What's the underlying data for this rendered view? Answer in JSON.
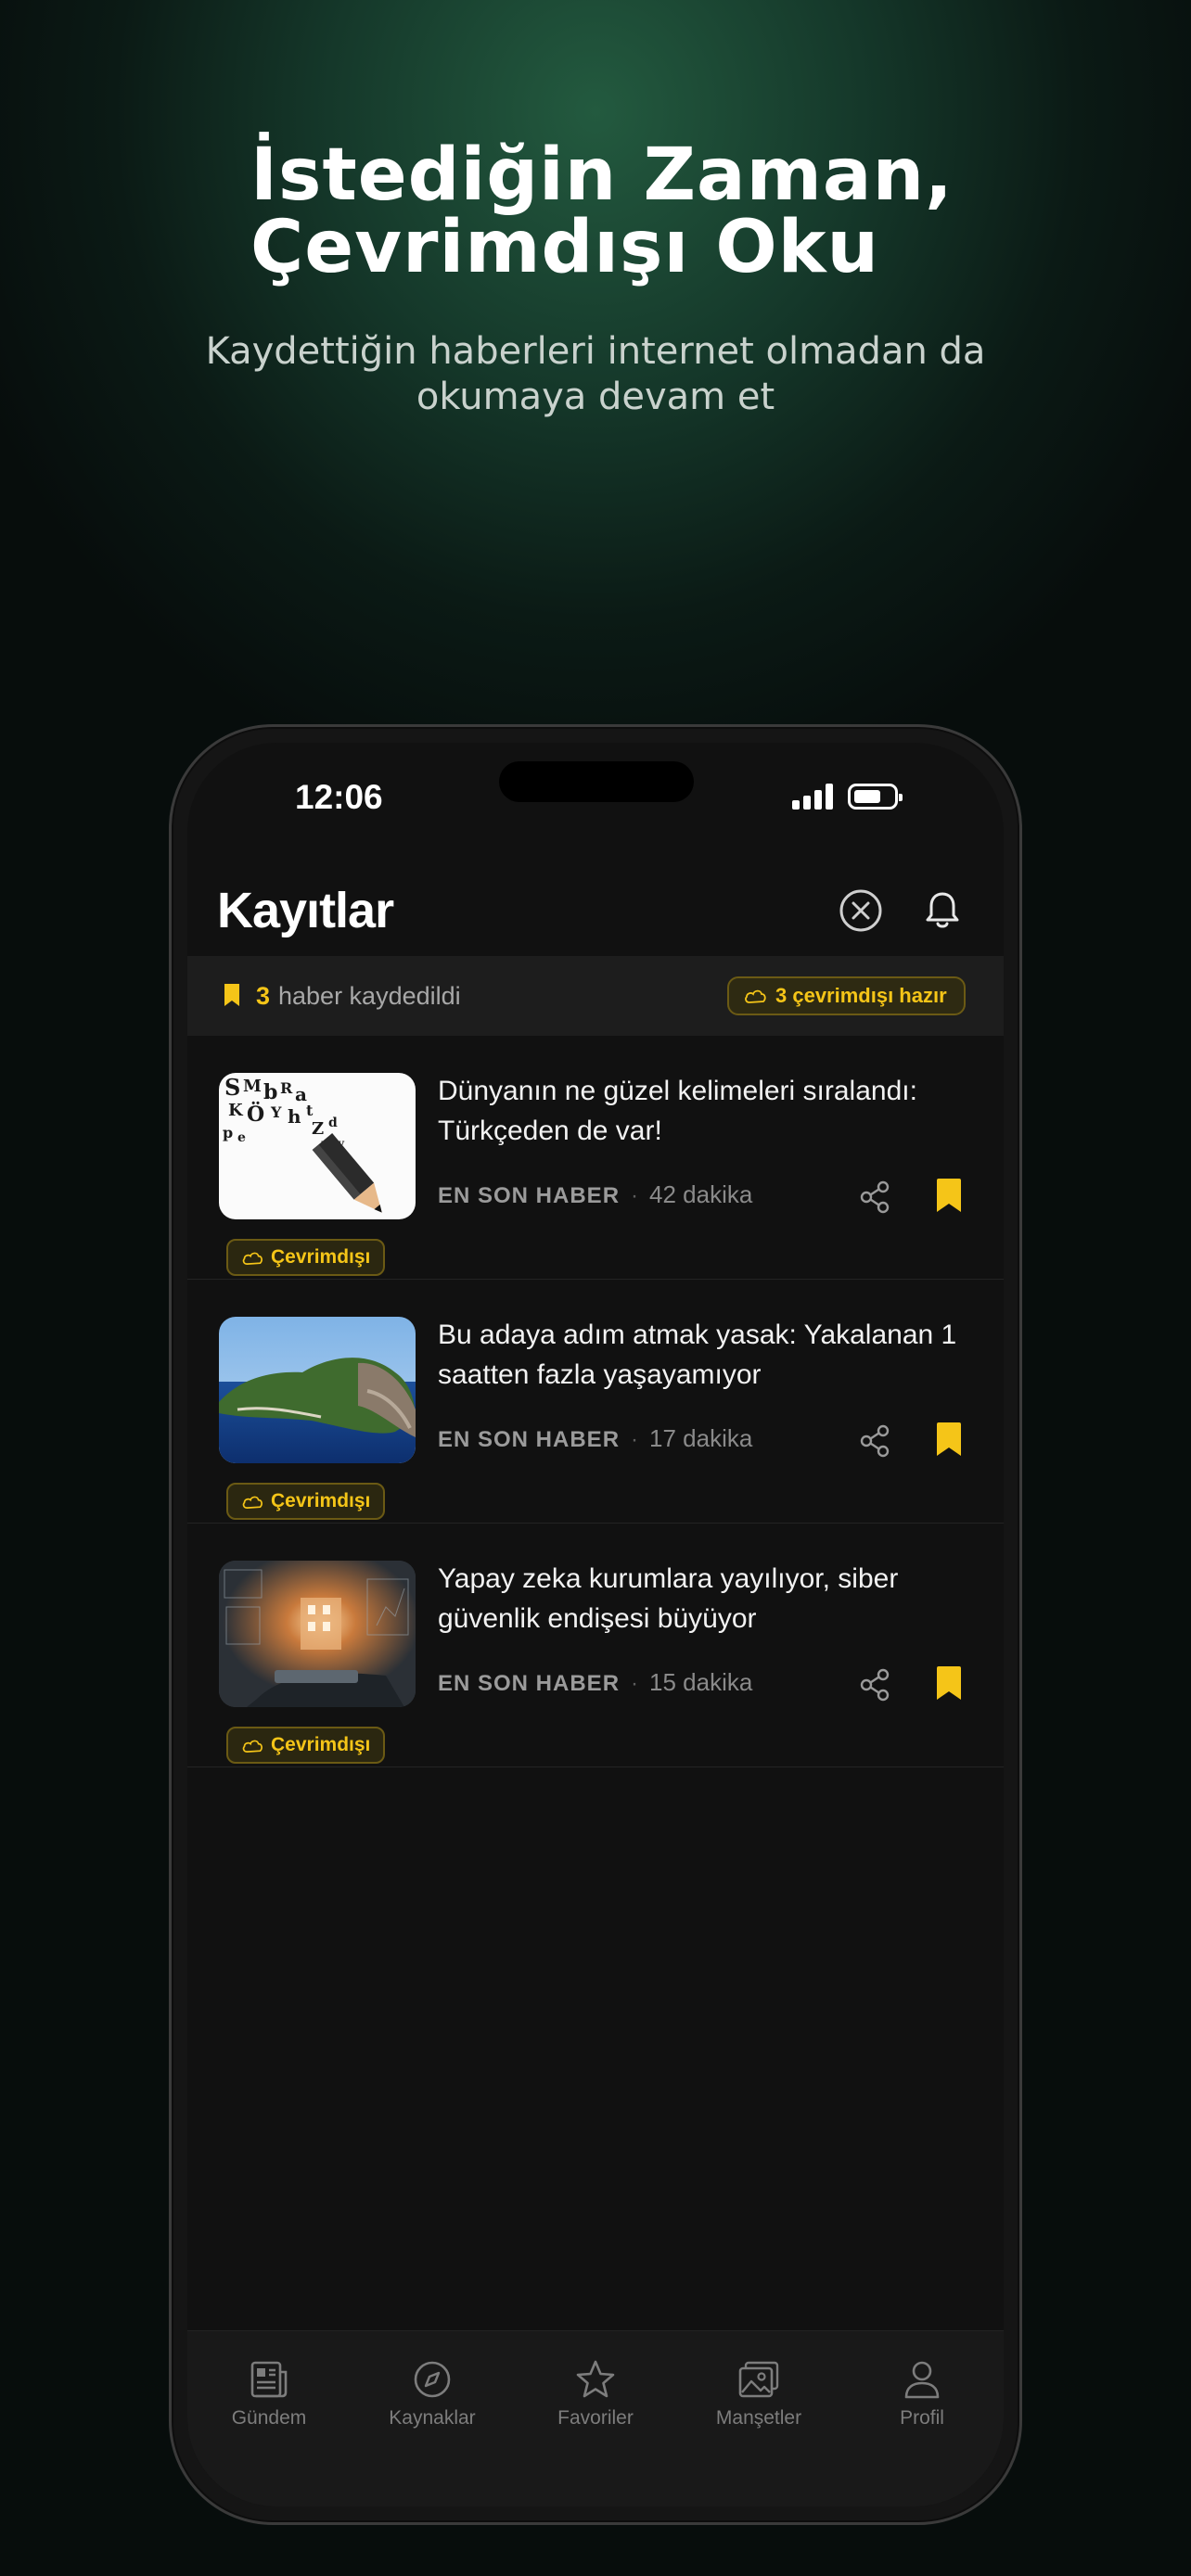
{
  "hero": {
    "title_line1": "İstediğin Zaman,",
    "title_line2": "Çevrimdışı Oku",
    "subtitle_line1": "Kaydettiğin haberleri internet olmadan da",
    "subtitle_line2": "okumaya devam et"
  },
  "status_bar": {
    "time": "12:06"
  },
  "header": {
    "title": "Kayıtlar"
  },
  "summary": {
    "count": "3",
    "label": "haber kaydedildi",
    "offline_ready": "3 çevrimdışı hazır"
  },
  "articles": [
    {
      "title": "Dünyanın ne güzel kelimeleri sıralandı: Türkçeden de var!",
      "source": "EN SON HABER",
      "age": "42 dakika",
      "badge": "Çevrimdışı",
      "thumb_icon": "pencil-letters-image"
    },
    {
      "title": "Bu adaya adım atmak yasak: Yakalanan 1 saatten fazla yaşayamıyor",
      "source": "EN SON HABER",
      "age": "17 dakika",
      "badge": "Çevrimdışı",
      "thumb_icon": "island-image"
    },
    {
      "title": "Yapay zeka kurumlara yayılıyor, siber güvenlik endişesi büyüyor",
      "source": "EN SON HABER",
      "age": "15 dakika",
      "badge": "Çevrimdışı",
      "thumb_icon": "cyber-tech-image"
    }
  ],
  "tabs": [
    {
      "label": "Gündem",
      "icon": "newspaper-icon"
    },
    {
      "label": "Kaynaklar",
      "icon": "compass-icon"
    },
    {
      "label": "Favoriler",
      "icon": "star-icon"
    },
    {
      "label": "Manşetler",
      "icon": "gallery-icon"
    },
    {
      "label": "Profil",
      "icon": "person-icon"
    }
  ],
  "colors": {
    "accent": "#f5c518",
    "background": "#111111",
    "hero_glow": "#235a3f"
  }
}
